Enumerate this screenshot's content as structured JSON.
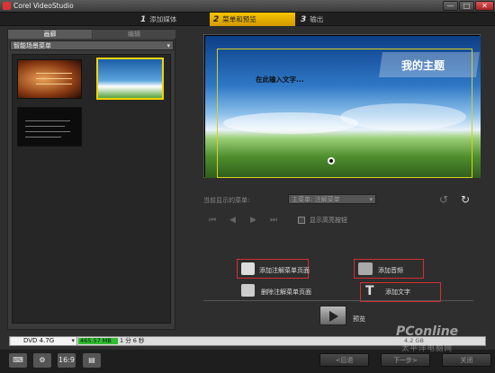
{
  "window": {
    "title": "Corel VideoStudio",
    "min": "—",
    "max": "□",
    "close": "✕"
  },
  "steps": [
    {
      "num": "1",
      "label": "添加媒体"
    },
    {
      "num": "2",
      "label": "菜单和预览"
    },
    {
      "num": "3",
      "label": "输出"
    }
  ],
  "left_panel": {
    "tab_gallery": "画廊",
    "tab_edit": "编辑",
    "template_category": "智能场景菜单",
    "thumbnails": [
      "orange-theme",
      "sky-theme",
      "black-theme"
    ]
  },
  "preview": {
    "theme_title": "我的主题",
    "subtitle": "在此输入文字..."
  },
  "controls": {
    "menu_label": "当前显示的菜单:",
    "menu_value": "主菜单: 注解菜单",
    "hq_label": "显示高亮按钮"
  },
  "actions": {
    "add_menu": "添加注解菜单页面",
    "delete_menu": "删除注解菜单页面",
    "add_music": "添加音频",
    "add_text": "添加文字",
    "preview": "预览"
  },
  "disc": {
    "type": "DVD 4.7G",
    "size": "465.57 MB",
    "duration": "1 分 6 秒",
    "right_info": "4.2 GB"
  },
  "bottom": {
    "tool_keyboard": "⌨",
    "tool_gear": "⚙",
    "tool_169": "16:9",
    "tool_print": "▤",
    "back": "<后退",
    "next": "下一步>",
    "close": "关闭"
  },
  "watermark": {
    "logo": "PConline",
    "cn": "太平洋电脑网"
  },
  "colors": {
    "accent": "#f5c400",
    "highlight_border": "#d03030",
    "disc_fill": "#2fbe2f"
  },
  "icons": {
    "undo": "↺",
    "redo": "↻",
    "first": "⏮",
    "prev": "◀",
    "next": "▶",
    "last": "⏭",
    "text_tool": "T"
  }
}
